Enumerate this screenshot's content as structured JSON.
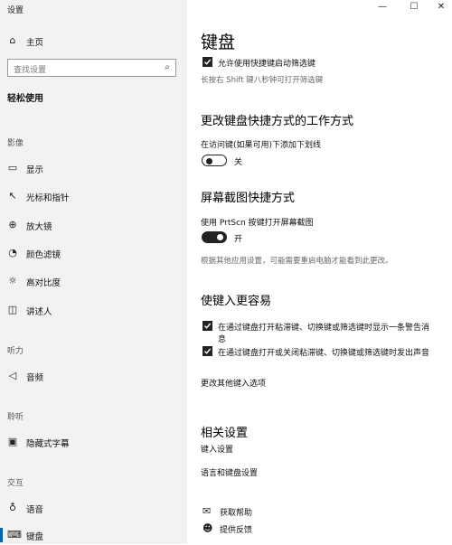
{
  "window": {
    "title": "设置"
  },
  "sidebar": {
    "home_label": "主页",
    "search_placeholder": "查找设置",
    "category_title": "轻松使用",
    "sections": {
      "vision": "影像",
      "hearing": "听力",
      "interaction": "交互"
    },
    "items": [
      {
        "label": "显示",
        "icon": "monitor-icon"
      },
      {
        "label": "光标和指针",
        "icon": "cursor-icon"
      },
      {
        "label": "放大镜",
        "icon": "magnifier-icon"
      },
      {
        "label": "颜色滤镜",
        "icon": "palette-icon"
      },
      {
        "label": "高对比度",
        "icon": "sun-icon"
      },
      {
        "label": "讲述人",
        "icon": "narrator-icon"
      },
      {
        "label": "音频",
        "icon": "speaker-icon"
      },
      {
        "label": "隐藏式字幕",
        "icon": "captions-icon"
      },
      {
        "label": "语音",
        "icon": "microphone-icon"
      },
      {
        "label": "键盘",
        "icon": "keyboard-icon"
      }
    ]
  },
  "main": {
    "title": "键盘",
    "filter_keys_checkbox": {
      "label": "允许使用快捷键启动筛选键",
      "checked": true
    },
    "filter_keys_hint": "长按右 Shift 键八秒钟可打开筛选键",
    "shortcut_section": {
      "heading": "更改键盘快捷方式的工作方式",
      "underline_label": "在访问键(如果可用)下添加下划线",
      "toggle_state": "关",
      "toggle_on": false
    },
    "printscreen_section": {
      "heading": "屏幕截图快捷方式",
      "label": "使用 PrtScn 按键打开屏幕截图",
      "toggle_state": "开",
      "toggle_on": true,
      "hint": "根据其他应用设置，可能需要重启电脑才能看到此更改。"
    },
    "typing_section": {
      "heading": "使键入更容易",
      "checkbox1_line1": "在通过键盘打开粘滞键、切换键或筛选键时显示一条警告消",
      "checkbox1_line2": "息",
      "checkbox2": "在通过键盘打开或关闭粘滞键、切换键或筛选键时发出声音",
      "link": "更改其他键入选项"
    },
    "related": {
      "heading": "相关设置",
      "link1": "键入设置",
      "link2": "语言和键盘设置"
    },
    "help": {
      "get_help": "获取帮助",
      "feedback": "提供反馈"
    }
  }
}
